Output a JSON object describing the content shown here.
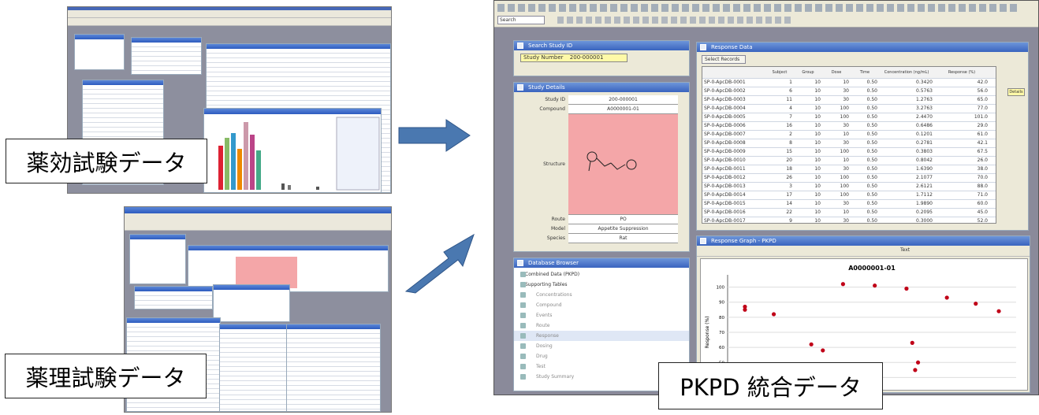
{
  "callouts": {
    "efficacy": "薬効試験データ",
    "pharmacology": "薬理試験データ",
    "integrated": "PKPD 統合データ"
  },
  "colors": {
    "arrow": "#4a78b0",
    "titlebar": "#3a64bf",
    "mdi_bg": "#8a8a9a",
    "structure_bg": "#f4a6a8",
    "label_yellow": "#fff9a8",
    "point": "#c00018"
  },
  "right_window": {
    "search_box": "Search",
    "study_panel": {
      "title": "Search Study ID",
      "label": "Study Number",
      "value": "200-000001"
    },
    "study_details": {
      "title": "Study Details",
      "rows": [
        {
          "key": "Study ID",
          "value": "200-000001"
        },
        {
          "key": "Compound",
          "value": "A0000001-01"
        },
        {
          "key": "Structure",
          "value": ""
        },
        {
          "key": "Route",
          "value": "PO"
        },
        {
          "key": "Model",
          "value": "Appetite Suppression"
        },
        {
          "key": "Species",
          "value": "Rat"
        }
      ]
    },
    "navigator": {
      "title": "Database Browser",
      "root1": "Combined Data (PKPD)",
      "root2": "Supporting Tables",
      "items": [
        "Concentrations",
        "Compound",
        "Events",
        "Route",
        "Response",
        "Dosing",
        "Drug",
        "Test",
        "Study Summary"
      ]
    },
    "results": {
      "title": "Response Data",
      "filter_button": "Select Records",
      "headers": [
        "",
        "Subject",
        "Group",
        "Dose",
        "Time",
        "Concentration (ng/mL)",
        "Response (%)"
      ],
      "rows": [
        [
          "SP-0-ApcDB-0001",
          "1",
          "10",
          "10",
          "0.50",
          "0.3420",
          "42.0"
        ],
        [
          "SP-0-ApcDB-0002",
          "6",
          "10",
          "30",
          "0.50",
          "0.5763",
          "56.0"
        ],
        [
          "SP-0-ApcDB-0003",
          "11",
          "10",
          "30",
          "0.50",
          "1.2763",
          "65.0"
        ],
        [
          "SP-0-ApcDB-0004",
          "4",
          "10",
          "100",
          "0.50",
          "3.2763",
          "77.0"
        ],
        [
          "SP-0-ApcDB-0005",
          "7",
          "10",
          "100",
          "0.50",
          "2.4470",
          "101.0"
        ],
        [
          "SP-0-ApcDB-0006",
          "16",
          "10",
          "30",
          "0.50",
          "0.6486",
          "29.0"
        ],
        [
          "SP-0-ApcDB-0007",
          "2",
          "10",
          "10",
          "0.50",
          "0.1201",
          "61.0"
        ],
        [
          "SP-0-ApcDB-0008",
          "8",
          "10",
          "30",
          "0.50",
          "0.2781",
          "42.1"
        ],
        [
          "SP-0-ApcDB-0009",
          "15",
          "10",
          "100",
          "0.50",
          "0.3803",
          "67.5"
        ],
        [
          "SP-0-ApcDB-0010",
          "20",
          "10",
          "10",
          "0.50",
          "0.8042",
          "26.0"
        ],
        [
          "SP-0-ApcDB-0011",
          "18",
          "10",
          "30",
          "0.50",
          "1.6390",
          "38.0"
        ],
        [
          "SP-0-ApcDB-0012",
          "26",
          "10",
          "100",
          "0.50",
          "2.1077",
          "70.0"
        ],
        [
          "SP-0-ApcDB-0013",
          "3",
          "10",
          "100",
          "0.50",
          "2.6121",
          "88.0"
        ],
        [
          "SP-0-ApcDB-0014",
          "17",
          "10",
          "100",
          "0.50",
          "1.7112",
          "71.0"
        ],
        [
          "SP-0-ApcDB-0015",
          "14",
          "10",
          "30",
          "0.50",
          "1.9890",
          "60.0"
        ],
        [
          "SP-0-ApcDB-0016",
          "22",
          "10",
          "10",
          "0.50",
          "0.2095",
          "45.0"
        ],
        [
          "SP-0-ApcDB-0017",
          "9",
          "10",
          "30",
          "0.50",
          "0.3000",
          "52.0"
        ],
        [
          "SP-0-ApcDB-0018",
          "5",
          "10",
          "30",
          "0.50",
          "0.6264",
          "43.0"
        ]
      ],
      "footer_button": "Details"
    },
    "chart_panel": {
      "title": "Response Graph - PKPD",
      "toolbar": "Text"
    }
  },
  "chart_data": {
    "type": "scatter",
    "title": "A0000001-01",
    "xlabel": "",
    "ylabel": "Response (%)",
    "yticks": [
      "100",
      "90",
      "80",
      "70",
      "60",
      "50",
      "40"
    ],
    "ylim": [
      35,
      105
    ],
    "xlim": [
      0,
      10
    ],
    "x": [
      0.6,
      0.6,
      1.6,
      2.9,
      3.3,
      4.0,
      5.1,
      6.2,
      6.4,
      6.6,
      7.6,
      8.6,
      9.4,
      1.1,
      2.3,
      6.5,
      1.7
    ],
    "y": [
      87,
      85,
      82,
      62,
      58,
      102,
      101,
      99,
      63,
      50,
      93,
      89,
      84,
      45,
      46,
      45,
      47
    ]
  }
}
